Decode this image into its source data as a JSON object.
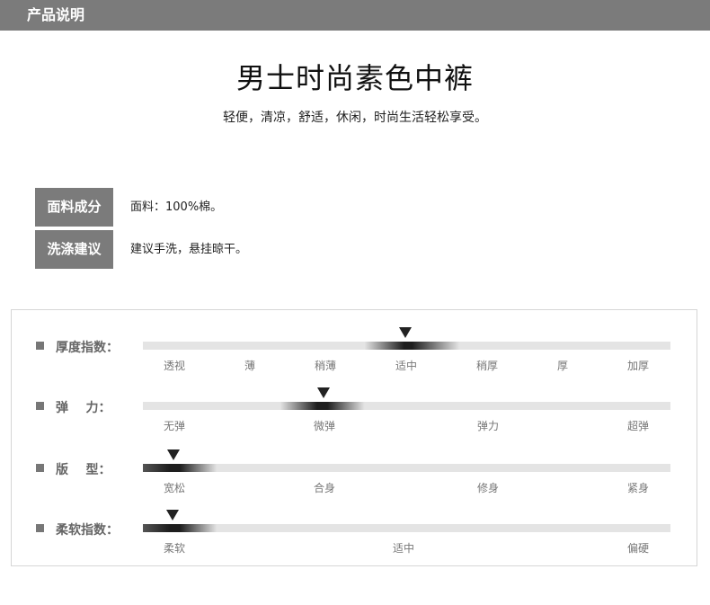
{
  "header": {
    "title": "产品说明"
  },
  "product": {
    "title": "男士时尚素色中裤",
    "subtitle": "轻便，清凉，舒适，休闲，时尚生活轻松享受。"
  },
  "specs": [
    {
      "label": "面料成分",
      "value": "面料：100%棉。"
    },
    {
      "label": "洗涤建议",
      "value": "建议手洗，悬挂晾干。"
    }
  ],
  "indicators": [
    {
      "label": "厚度指数：",
      "ticks": [
        "透视",
        "薄",
        "稍薄",
        "适中",
        "稍厚",
        "厚",
        "加厚"
      ],
      "selected": "适中"
    },
    {
      "label": "弹    力：",
      "ticks": [
        "无弹",
        "微弹",
        "弹力",
        "超弹"
      ],
      "selected": "微弹"
    },
    {
      "label": "版    型：",
      "ticks": [
        "宽松",
        "合身",
        "修身",
        "紧身"
      ],
      "selected": "宽松"
    },
    {
      "label": "柔软指数：",
      "ticks": [
        "柔软",
        "适中",
        "偏硬"
      ],
      "selected": "柔软"
    }
  ],
  "colors": {
    "bar": "#7b7b7b",
    "marker": "#222222",
    "track": "#e4e4e4"
  }
}
